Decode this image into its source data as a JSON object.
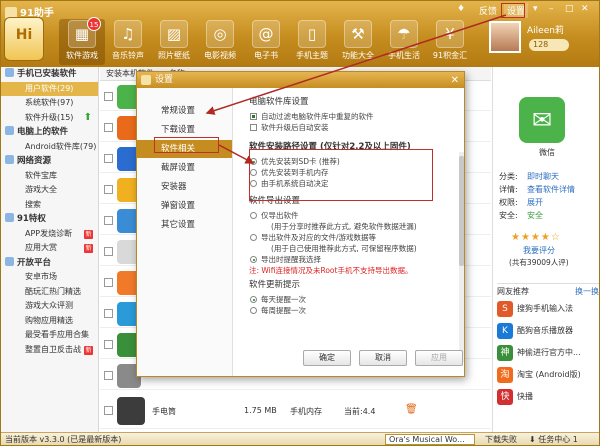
{
  "app": {
    "title": "91助手",
    "topright": {
      "feedback": "反馈",
      "settings": "设置"
    },
    "hi_label": "Hi",
    "badge": "15",
    "user": {
      "name": "Aileen莉",
      "coins": "128"
    }
  },
  "toolbar": [
    {
      "label": "软件游戏",
      "icon": "apps-icon"
    },
    {
      "label": "音乐铃声",
      "icon": "music-icon"
    },
    {
      "label": "照片壁纸",
      "icon": "photo-icon"
    },
    {
      "label": "电影视频",
      "icon": "film-icon"
    },
    {
      "label": "电子书",
      "icon": "book-icon"
    },
    {
      "label": "手机主题",
      "icon": "theme-icon"
    },
    {
      "label": "功能大全",
      "icon": "tools-icon"
    },
    {
      "label": "手机生活",
      "icon": "life-icon"
    },
    {
      "label": "91积金汇",
      "icon": "coin-icon"
    }
  ],
  "sidebar": [
    {
      "label": "手机已安装软件",
      "type": "group"
    },
    {
      "label": "用户软件(29)",
      "selected": true
    },
    {
      "label": "系统软件(97)"
    },
    {
      "label": "软件升级(15)",
      "up": true
    },
    {
      "label": "电脑上的软件",
      "type": "group"
    },
    {
      "label": "Android软件库(79)"
    },
    {
      "label": "网络资源",
      "type": "group"
    },
    {
      "label": "软件宝库"
    },
    {
      "label": "游戏大全"
    },
    {
      "label": "搜索"
    },
    {
      "label": "91特权",
      "type": "group"
    },
    {
      "label": "APP发烧诊断",
      "tag": "新"
    },
    {
      "label": "应用大赏",
      "tag": "新"
    },
    {
      "label": "开放平台",
      "type": "group"
    },
    {
      "label": "安卓市场"
    },
    {
      "label": "酷玩汇热门精选"
    },
    {
      "label": "游戏大众评测"
    },
    {
      "label": "购物应用精选"
    },
    {
      "label": "最受看手应用合集"
    },
    {
      "label": "整置自卫反击战",
      "tag": "新"
    }
  ],
  "list": {
    "tabs": [
      "安装本机软件",
      "名称"
    ],
    "bottom_row": {
      "name": "手电筒",
      "size": "1.75 MB",
      "location": "手机内存",
      "version": "当前:4.4"
    }
  },
  "right": {
    "app_name": "微信",
    "fields": [
      {
        "k": "分类:",
        "v": "即时聊天"
      },
      {
        "k": "详情:",
        "v": "查看软件详情"
      },
      {
        "k": "权限:",
        "v": "展开"
      },
      {
        "k": "安全:",
        "v": "安全"
      }
    ],
    "rate_label": "我要评分",
    "rating_count": "(共有39009人评)",
    "recommend_title": "网友推荐",
    "recommend_more": "换一换",
    "recommends": [
      {
        "label": "搜狗手机输入法",
        "color": "#e05a2a",
        "glyph": "S"
      },
      {
        "label": "酷狗音乐播放器",
        "color": "#1a7ad8",
        "glyph": "K"
      },
      {
        "label": "神偷进行官方中...",
        "color": "#3a8f3a",
        "glyph": "神"
      },
      {
        "label": "淘宝 (Android版)",
        "color": "#f26b1d",
        "glyph": "淘"
      },
      {
        "label": "快播",
        "color": "#d23030",
        "glyph": "快"
      }
    ]
  },
  "status": {
    "version": "当前版本 v3.3.0 (已是最新版本)",
    "download": "Ora's Musical Wo...",
    "fail": "下载失败",
    "tasks": "任务中心 1"
  },
  "dialog": {
    "title": "设置",
    "nav": [
      "常规设置",
      "下载设置",
      "软件相关",
      "截屏设置",
      "安装器",
      "弹窗设置",
      "其它设置"
    ],
    "nav_selected": 2,
    "section1": {
      "title": "电脑软件库设置",
      "options": [
        {
          "label": "自动过滤电脑软件库中重复的软件",
          "checked": true
        },
        {
          "label": "软件升级后自动安装",
          "checked": false
        }
      ]
    },
    "section2": {
      "title": "软件安装路径设置 (仅针对2.2及以上固件)",
      "options": [
        {
          "label": "优先安装到SD卡 (推荐)",
          "checked": true
        },
        {
          "label": "优先安装到手机内存",
          "checked": false
        },
        {
          "label": "由手机系统自动决定",
          "checked": false
        }
      ]
    },
    "section3": {
      "title": "软件导出设置",
      "options": [
        {
          "label": "仅导出软件",
          "checked": false
        },
        {
          "label": "(用于分享时推荐此方式, 避免软件数据泄漏)",
          "checked": null
        },
        {
          "label": "导出软件及对应的文件/游戏数据等",
          "checked": false
        },
        {
          "label": "(用于自己使用推荐此方式, 可保留程序数据)",
          "checked": null
        },
        {
          "label": "导出时提醒我选择",
          "checked": true
        }
      ],
      "note": "注: Wifi连接情况及未Root手机不支持导出数据。"
    },
    "section4": {
      "title": "软件更新提示",
      "options": [
        {
          "label": "每天提醒一次",
          "checked": true
        },
        {
          "label": "每周提醒一次",
          "checked": false
        }
      ]
    },
    "buttons": {
      "ok": "确定",
      "cancel": "取消",
      "apply": "应用"
    }
  }
}
